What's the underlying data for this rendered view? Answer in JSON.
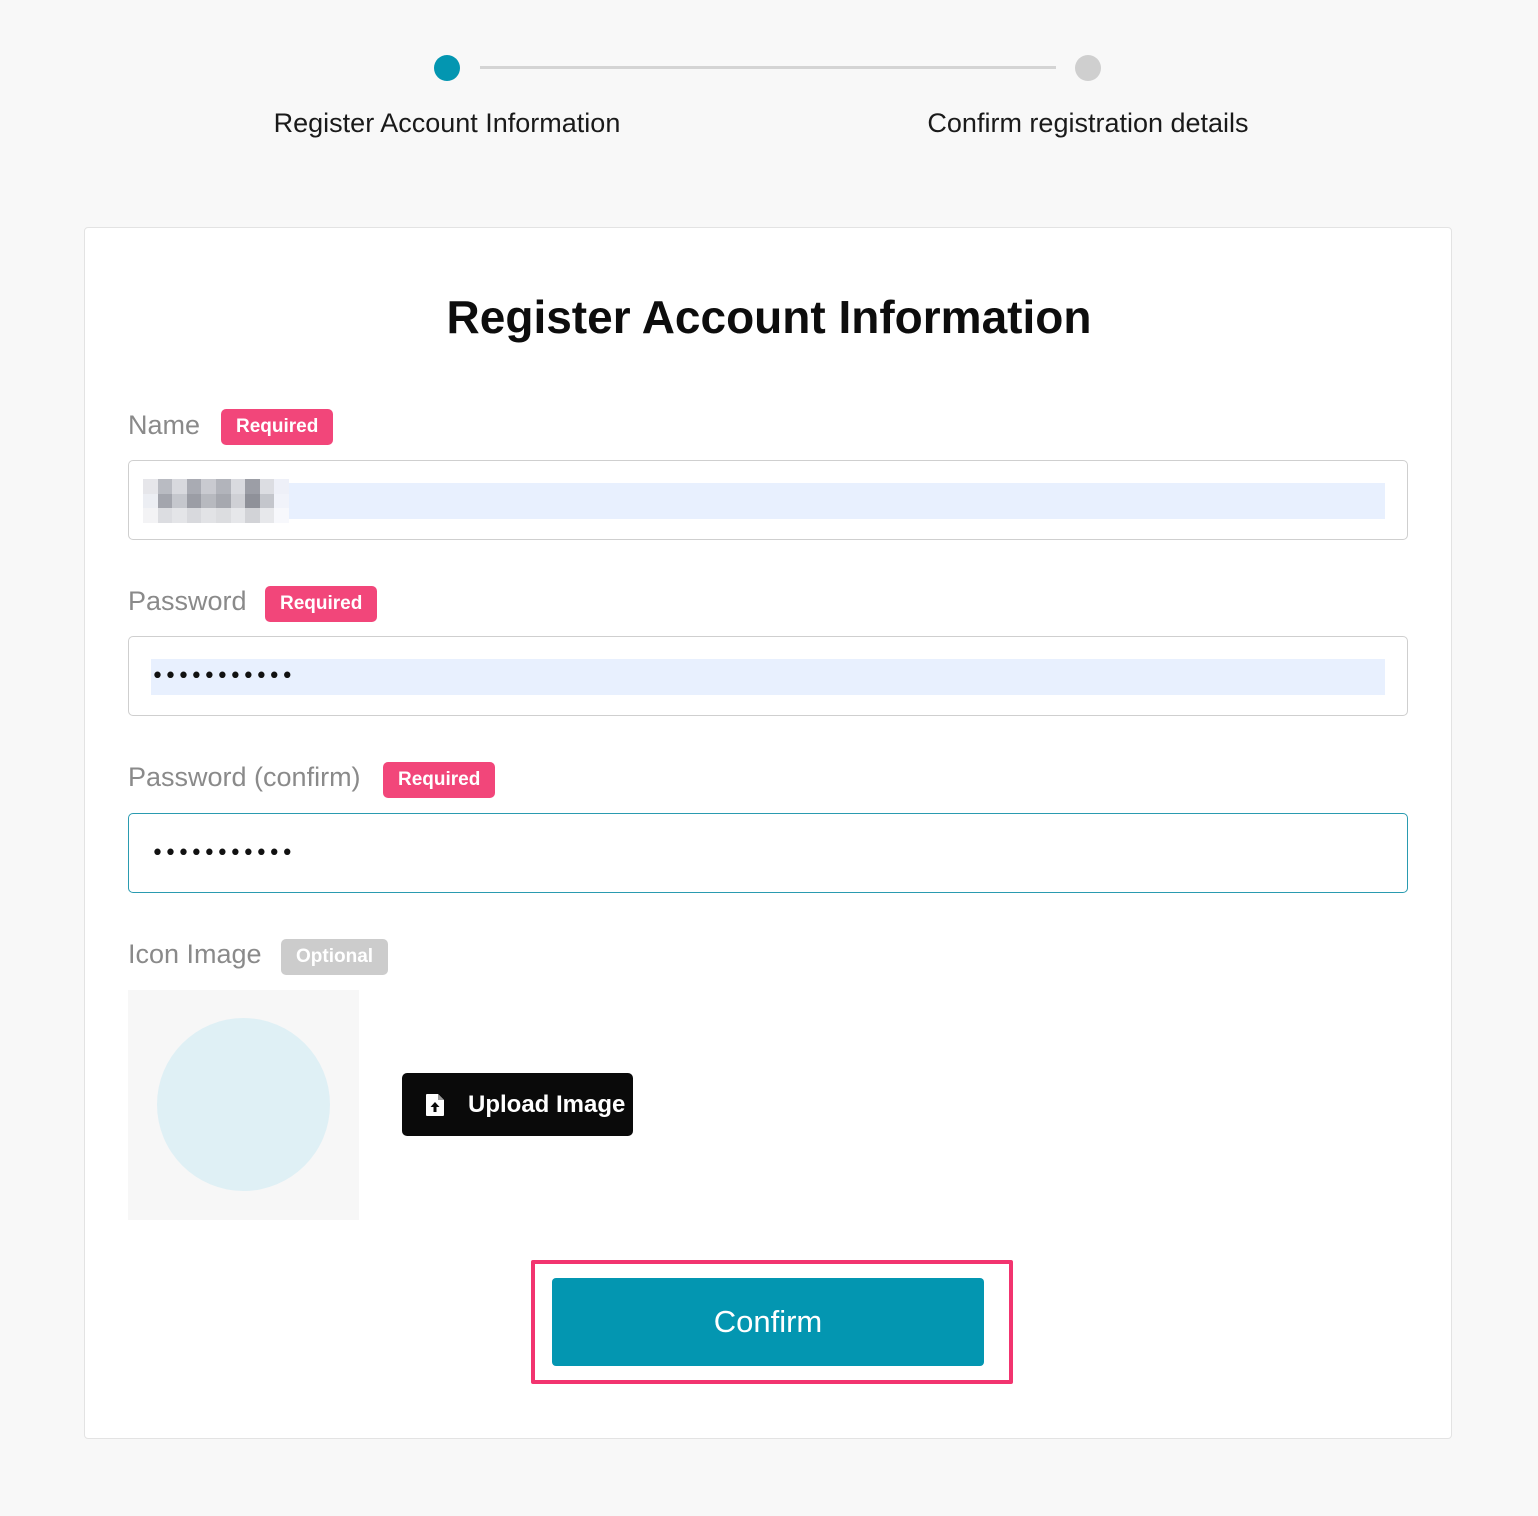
{
  "stepper": {
    "steps": [
      {
        "label": "Register Account Information",
        "state": "active"
      },
      {
        "label": "Confirm registration details",
        "state": "inactive"
      }
    ]
  },
  "form": {
    "title": "Register Account Information",
    "fields": {
      "name": {
        "label": "Name",
        "badge": "Required",
        "value": ""
      },
      "password": {
        "label": "Password",
        "badge": "Required",
        "value": "•••••••••••"
      },
      "password_confirm": {
        "label": "Password (confirm)",
        "badge": "Required",
        "value": "•••••••••••"
      },
      "icon_image": {
        "label": "Icon Image",
        "badge": "Optional"
      }
    },
    "upload_button": {
      "label": "Upload Image",
      "icon": "file-upload-icon"
    },
    "confirm_button": {
      "label": "Confirm"
    }
  },
  "colors": {
    "accent": "#0396b1",
    "required_badge": "#f2467a",
    "optional_badge": "#cccccc",
    "highlight": "#f2346f",
    "autofill": "#e8f0fe"
  }
}
